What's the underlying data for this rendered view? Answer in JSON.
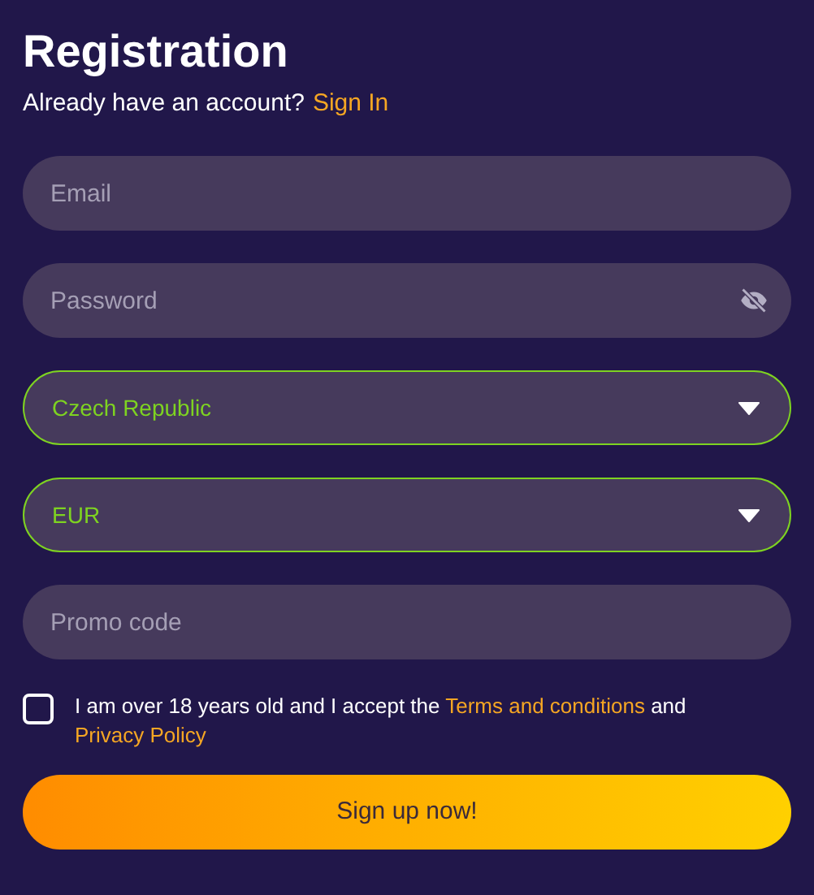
{
  "title": "Registration",
  "subtitle": {
    "text": "Already have an account?",
    "link": "Sign In"
  },
  "fields": [
    {
      "kind": "input",
      "placeholder": "Email"
    },
    {
      "kind": "password",
      "placeholder": "Password"
    },
    {
      "kind": "select",
      "value": "Czech Republic",
      "valid": true
    },
    {
      "kind": "select",
      "value": "EUR",
      "valid": true
    },
    {
      "kind": "input",
      "placeholder": "Promo code"
    }
  ],
  "consent": {
    "checked": false,
    "text_before": "I am over 18 years old and I accept the",
    "terms_link": "Terms and conditions",
    "text_middle": "and",
    "privacy_link": "Privacy Policy"
  },
  "submit": "Sign up now!"
}
